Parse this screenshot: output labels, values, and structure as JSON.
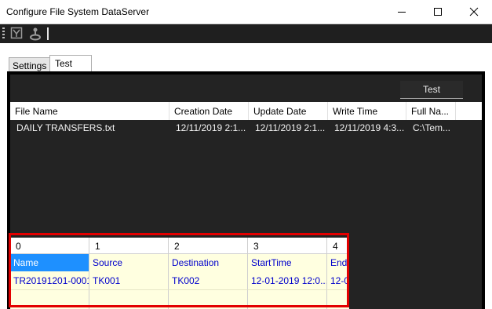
{
  "window": {
    "title": "Configure File System DataServer"
  },
  "tabs": [
    {
      "label": "Settings"
    },
    {
      "label": "Test"
    }
  ],
  "actions": {
    "test_label": "Test"
  },
  "files_grid": {
    "columns": [
      "File Name",
      "Creation Date",
      "Update Date",
      "Write Time",
      "Full Na..."
    ],
    "rows": [
      [
        "DAILY TRANSFERS.txt",
        "12/11/2019 2:1...",
        "12/11/2019 2:1...",
        "12/11/2019 4:3...",
        "C:\\Tem..."
      ]
    ]
  },
  "data_grid": {
    "indices": [
      "0",
      "1",
      "2",
      "3",
      "4"
    ],
    "headers": [
      "Name",
      "Source",
      "Destination",
      "StartTime",
      "End"
    ],
    "rows": [
      [
        "TR20191201-0001",
        "TK001",
        "TK002",
        "12-01-2019 12:0...",
        "12-0"
      ]
    ]
  },
  "colors": {
    "highlight": "#e30000",
    "selected_header": "#1e90ff",
    "grid_cell_bg": "#ffffe0",
    "grid_text": "#0000cc"
  }
}
